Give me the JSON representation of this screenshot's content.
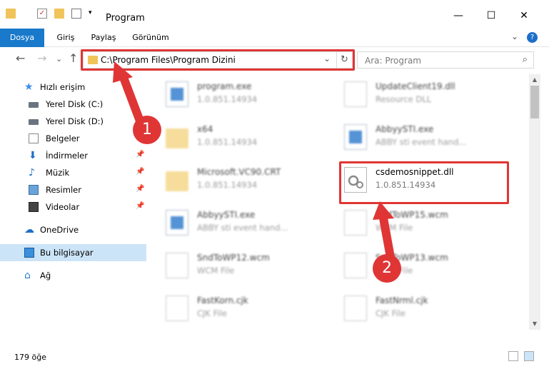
{
  "window": {
    "title": "Program",
    "minimize_glyph": "—",
    "maximize_glyph": "☐",
    "close_glyph": "✕"
  },
  "ribbon": {
    "tabs": [
      {
        "label": "Dosya",
        "active": true
      },
      {
        "label": "Giriş"
      },
      {
        "label": "Paylaş"
      },
      {
        "label": "Görünüm"
      }
    ],
    "expand_glyph": "⌄",
    "help_glyph": "?"
  },
  "nav": {
    "back_glyph": "←",
    "forward_glyph": "→",
    "recent_glyph": "⌄",
    "up_glyph": "↑",
    "address": "C:\\Program Files\\Program Dizini",
    "address_chevron": "⌄",
    "refresh_glyph": "↻",
    "search_placeholder": "Ara: Program",
    "search_glyph": "⌕"
  },
  "sidebar": {
    "items": [
      {
        "label": "Hızlı erişim",
        "icon": "star-icon"
      },
      {
        "label": "Yerel Disk (C:)",
        "icon": "drive-icon"
      },
      {
        "label": "Yerel Disk (D:)",
        "icon": "drive-icon"
      },
      {
        "label": "Belgeler",
        "icon": "documents-icon",
        "pinned": true
      },
      {
        "label": "İndirmeler",
        "icon": "downloads-icon",
        "pinned": true
      },
      {
        "label": "Müzik",
        "icon": "music-icon",
        "pinned": true
      },
      {
        "label": "Resimler",
        "icon": "pictures-icon",
        "pinned": true
      },
      {
        "label": "Videolar",
        "icon": "videos-icon",
        "pinned": true
      },
      {
        "label": "OneDrive",
        "icon": "onedrive-icon"
      },
      {
        "label": "Bu bilgisayar",
        "icon": "computer-icon",
        "selected": true
      },
      {
        "label": "Ağ",
        "icon": "network-icon"
      }
    ],
    "pin_glyph": "📌"
  },
  "files": [
    {
      "name": "program.exe",
      "desc": "1.0.851.14934",
      "icon": "exe-icon"
    },
    {
      "name": "UpdateClient19.dll",
      "desc": "Resource DLL",
      "icon": "dll-icon"
    },
    {
      "name": "x64",
      "desc": "1.0.851.14934",
      "icon": "folder-icon"
    },
    {
      "name": "AbbyySTI.exe",
      "desc": "ABBY sti event hand...",
      "icon": "exe-icon"
    },
    {
      "name": "Microsoft.VC90.CRT",
      "desc": "1.0.851.14934",
      "icon": "folder-icon"
    },
    {
      "name": "csdemosnippet.dll",
      "desc": "1.0.851.14934",
      "icon": "dll-gear-icon",
      "highlighted": true
    },
    {
      "name": "AbbyySTI.exe",
      "desc": "ABBY sti event hand...",
      "icon": "exe-icon"
    },
    {
      "name": "SndToWP15.wcm",
      "desc": "WCM File",
      "icon": "file-icon"
    },
    {
      "name": "SndToWP12.wcm",
      "desc": "WCM File",
      "icon": "file-icon"
    },
    {
      "name": "SndToWP13.wcm",
      "desc": "WCM File",
      "icon": "file-icon"
    },
    {
      "name": "FastKorn.cjk",
      "desc": "CJK File",
      "icon": "file-icon"
    },
    {
      "name": "FastNrml.cjk",
      "desc": "CJK File",
      "icon": "file-icon"
    }
  ],
  "status": {
    "count": "179 öğe"
  },
  "callouts": {
    "one": "1",
    "two": "2",
    "color": "#e03535"
  }
}
